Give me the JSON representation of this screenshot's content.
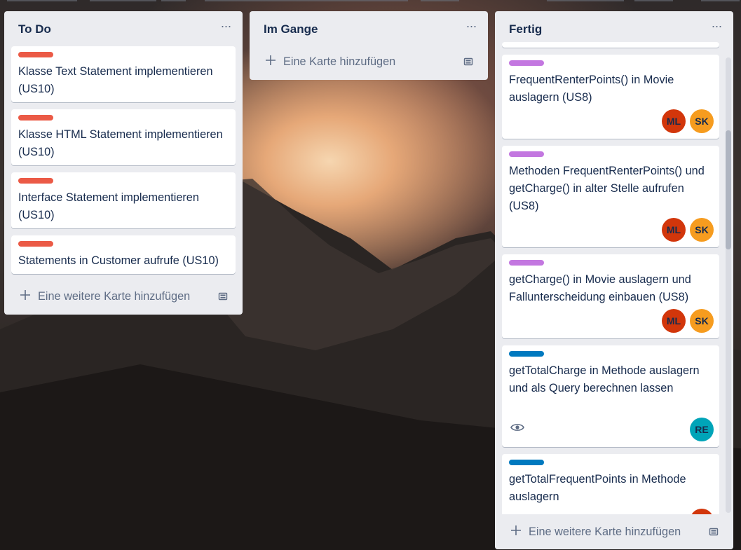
{
  "lists": [
    {
      "title": "To Do",
      "cards": [
        {
          "label_color": "#eb5a46",
          "text": "Klasse Text Statement implementieren (US10)"
        },
        {
          "label_color": "#eb5a46",
          "text": "Klasse HTML Statement implementieren (US10)"
        },
        {
          "label_color": "#eb5a46",
          "text": "Interface Statement implementieren (US10)"
        },
        {
          "label_color": "#eb5a46",
          "text": "Statements in Customer aufrufe (US10)"
        }
      ],
      "add_label": "Eine weitere Karte hinzufügen"
    },
    {
      "title": "Im Gange",
      "cards": [],
      "add_label": "Eine Karte hinzufügen"
    },
    {
      "title": "Fertig",
      "cards": [
        {
          "label_color": "#c377e0",
          "text": "FrequentRenterPoints() in Movie auslagern (US8)",
          "members": [
            "ML",
            "SK"
          ]
        },
        {
          "label_color": "#c377e0",
          "text": "Methoden FrequentRenterPoints() und getCharge() in alter Stelle aufrufen (US8)",
          "members": [
            "ML",
            "SK"
          ]
        },
        {
          "label_color": "#c377e0",
          "text": "getCharge() in Movie auslagern und Fallunterscheidung einbauen (US8)",
          "members": [
            "ML",
            "SK"
          ]
        },
        {
          "label_color": "#0079bf",
          "text": "getTotalCharge in Methode auslagern und als Query berechnen lassen",
          "members": [
            "RE"
          ],
          "badges": [
            "eye-icon"
          ]
        },
        {
          "label_color": "#0079bf",
          "text": "getTotalFrequentPoints in Methode auslagern",
          "members": [
            "ML"
          ]
        }
      ],
      "add_label": "Eine weitere Karte hinzufügen"
    }
  ],
  "icons": {
    "menu": "ellipsis-icon",
    "add": "plus-icon",
    "template": "card-template-icon",
    "watch": "eye-icon"
  },
  "menu_glyph": "···"
}
